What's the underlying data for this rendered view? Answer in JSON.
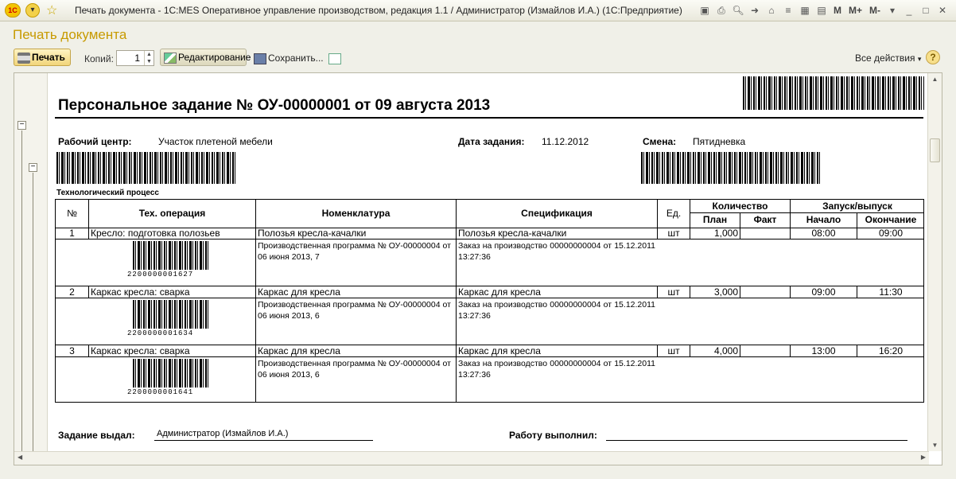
{
  "window": {
    "title": "Печать документа - 1C:MES Оперативное управление производством, редакция 1.1 / Администратор (Измайлов И.А.)  (1С:Предприятие)",
    "logo": "1С",
    "icons": [
      "save-icon",
      "print-icon",
      "preview-icon",
      "arrow-icon",
      "home-icon",
      "list-icon",
      "calculator-icon",
      "calendar-icon"
    ],
    "mem_buttons": [
      "M",
      "M+",
      "M-"
    ]
  },
  "form": {
    "title": "Печать документа",
    "print_label": "Печать",
    "copies_label": "Копий:",
    "copies_value": "1",
    "edit_label": "Редактирование",
    "save_label": "Сохранить...",
    "all_actions": "Все действия",
    "help": "?"
  },
  "document": {
    "title": "Персональное задание № ОУ-00000001 от 09 августа 2013",
    "work_center_label": "Рабочий центр:",
    "work_center": "Участок плетеной мебели",
    "date_label": "Дата задания:",
    "date": "11.12.2012",
    "shift_label": "Смена:",
    "shift": "Пятидневка",
    "process_caption": "Технологический процесс",
    "headers": {
      "num": "№",
      "operation": "Тех. операция",
      "nomenclature": "Номенклатура",
      "specification": "Спецификация",
      "unit": "Ед.",
      "quantity": "Количество",
      "plan": "План",
      "fact": "Факт",
      "launch": "Запуск/выпуск",
      "start": "Начало",
      "end": "Окончание"
    },
    "rows": [
      {
        "num": "1",
        "operation": "Кресло: подготовка полозьев",
        "nomenclature": "Полозья кресла-качалки",
        "specification": "Полозья кресла-качалки",
        "unit": "шт",
        "plan": "1,000",
        "fact": "",
        "start": "08:00",
        "end": "09:00",
        "program": "Производственная программа № ОУ-00000004 от 06 июня 2013, 7",
        "order": "Заказ на производство 00000000004 от 15.12.2011 13:27:36",
        "barcode": "2200000001627"
      },
      {
        "num": "2",
        "operation": "Каркас кресла: сварка",
        "nomenclature": "Каркас для кресла",
        "specification": "Каркас для кресла",
        "unit": "шт",
        "plan": "3,000",
        "fact": "",
        "start": "09:00",
        "end": "11:30",
        "program": "Производственная программа № ОУ-00000004 от 06 июня 2013, 6",
        "order": "Заказ на производство 00000000004 от 15.12.2011 13:27:36",
        "barcode": "2200000001634"
      },
      {
        "num": "3",
        "operation": "Каркас кресла: сварка",
        "nomenclature": "Каркас для кресла",
        "specification": "Каркас для кресла",
        "unit": "шт",
        "plan": "4,000",
        "fact": "",
        "start": "13:00",
        "end": "16:20",
        "program": "Производственная программа № ОУ-00000004 от 06 июня 2013, 6",
        "order": "Заказ на производство 00000000004 от 15.12.2011 13:27:36",
        "barcode": "2200000001641"
      }
    ],
    "issued_label": "Задание выдал:",
    "issued_by": "Администратор (Измайлов И.А.)",
    "performed_label": "Работу выполнил:"
  }
}
